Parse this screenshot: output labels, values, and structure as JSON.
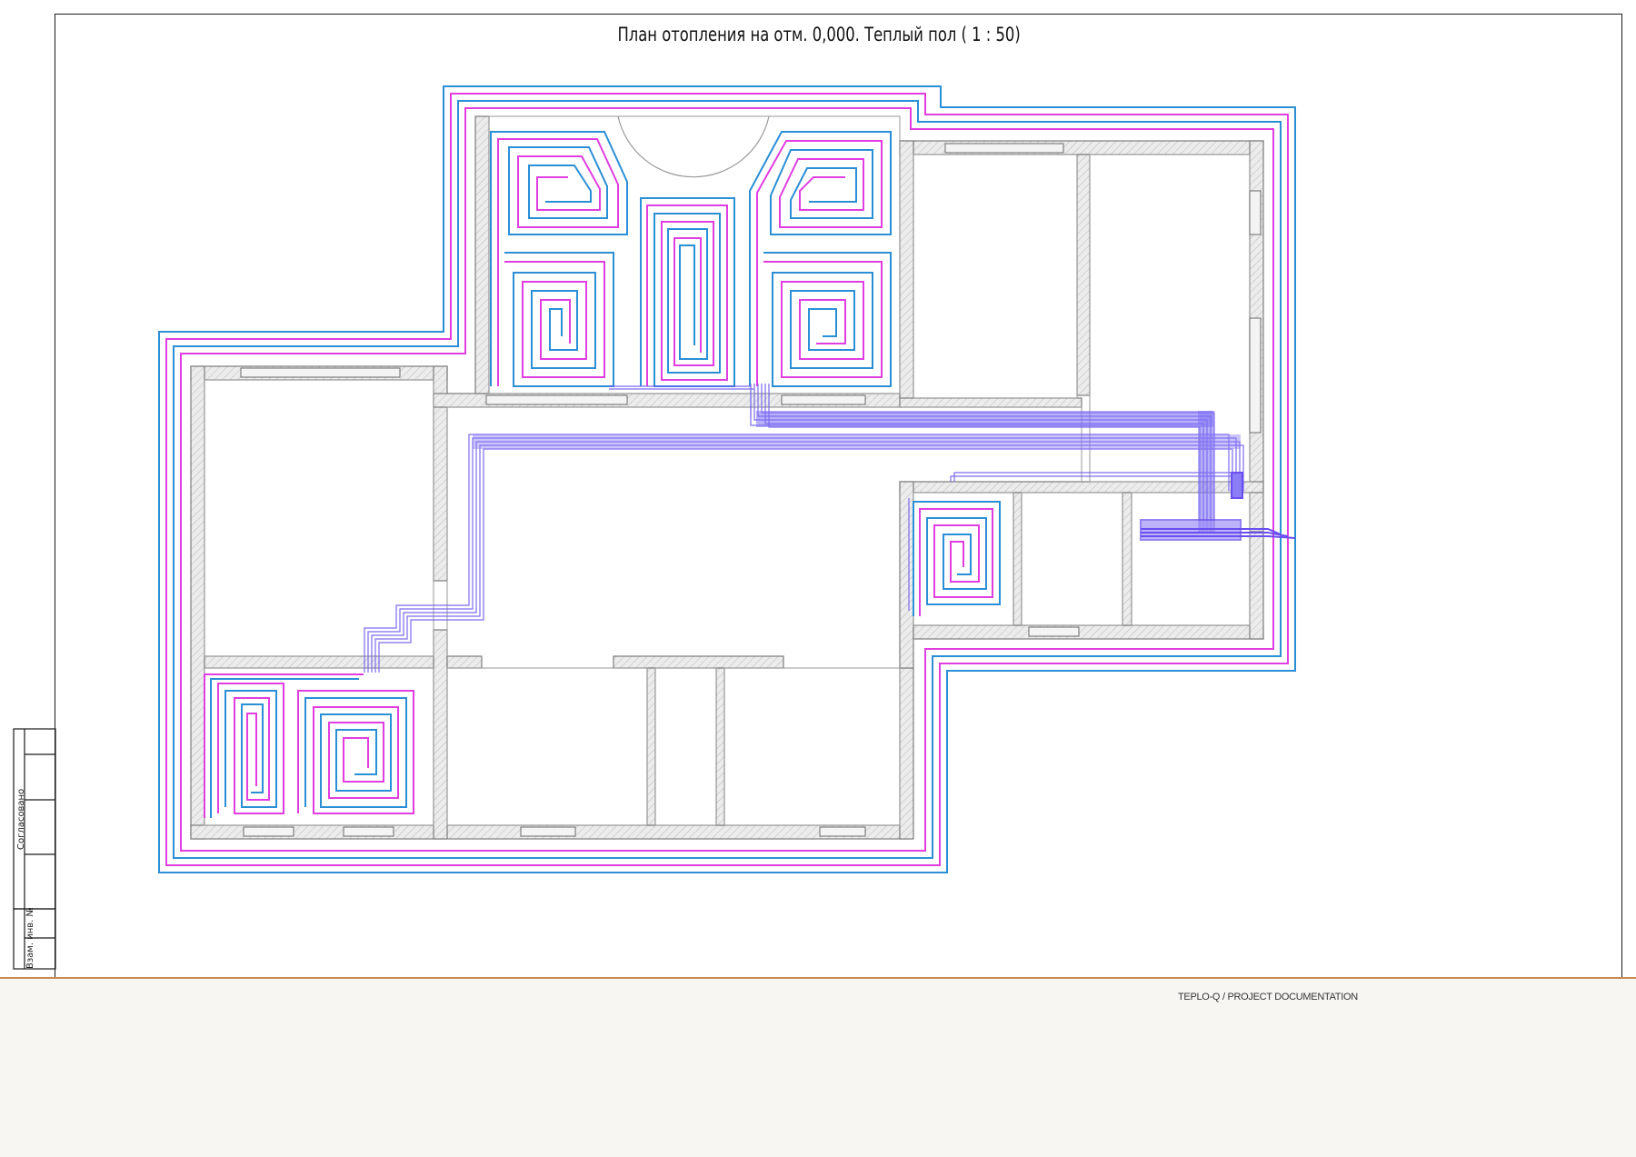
{
  "drawing": {
    "title": "План отопления на отм. 0,000. Теплый пол ( 1 : 50)"
  },
  "stamp": {
    "approved_label": "Согласовано",
    "replace_label": "Взам. инв. №"
  },
  "footer": {
    "brand": "TEPLO-Q / PROJECT DOCUMENTATION"
  },
  "colors": {
    "supply": "#e03ee0",
    "return": "#2b8fd6",
    "manifold": "#6f5cf0",
    "wall": "#7d7d7d",
    "separator": "#c98a55"
  }
}
